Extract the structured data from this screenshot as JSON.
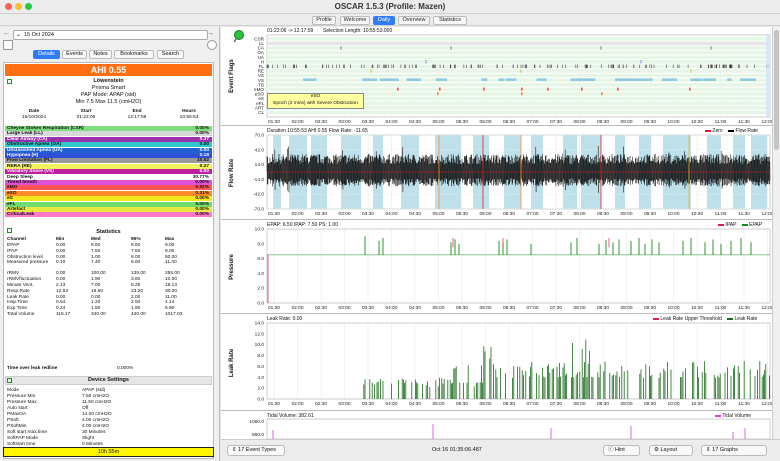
{
  "window": {
    "title": "OSCAR 1.5.3 (Profile: Mazen)"
  },
  "tabs": [
    {
      "label": "Profile"
    },
    {
      "label": "Welcome"
    },
    {
      "label": "Daily"
    },
    {
      "label": "Overview"
    },
    {
      "label": "Statistics"
    }
  ],
  "date": {
    "value": "15 Oct 2024"
  },
  "detail_tabs": [
    {
      "label": "Details"
    },
    {
      "label": "Events"
    },
    {
      "label": "Notes"
    },
    {
      "label": "Bookmarks"
    },
    {
      "label": "Search"
    }
  ],
  "summary": {
    "ahi": "AHI 0.55",
    "machine": "Löwenstein",
    "model": "Prisma Smart",
    "mode": "PAP Mode: APAP (std)",
    "pressure": "Min 7.5 Max 11.5 (cmH2O)"
  },
  "session": {
    "headers": [
      "Date",
      "Start",
      "End",
      "Hours"
    ],
    "values": [
      "16/10/2024",
      "01:22:06",
      "12:17:59",
      "10:55:53"
    ]
  },
  "events": [
    {
      "name": "Cheyne Stokes Respiration (CSR)",
      "value": "0.00%",
      "color": "#7fdc7f"
    },
    {
      "name": "Large Leak (LL)",
      "value": "0.00%",
      "color": "#d8d8d8"
    },
    {
      "name": "Clear Airway (CA)",
      "value": "0.37",
      "color": "#9b2fae",
      "text": "#ffffff"
    },
    {
      "name": "Obstructive Apnea (OA)",
      "value": "0.00",
      "color": "#2ec8c8"
    },
    {
      "name": "Unclassified Apnea (UA)",
      "value": "0.00",
      "color": "#2060d0",
      "text": "#ffffff"
    },
    {
      "name": "Hypopnea (H)",
      "value": "0.18",
      "color": "#2f4fd8",
      "text": "#ffffff"
    },
    {
      "name": "Flow Limitation (FL)",
      "value": "10.52",
      "color": "#9a9a9a"
    },
    {
      "name": "RERA (RE)",
      "value": "0.27",
      "color": "#f2f25a"
    },
    {
      "name": "Vibratory Snore (VS)",
      "value": "0.00",
      "color": "#c020a0",
      "text": "#ffffff"
    },
    {
      "name": "Deep Sleep",
      "value": "30.77%",
      "color": "#ffffff"
    },
    {
      "name": "Timed breath",
      "value": "0.00%",
      "color": "#e050d8"
    },
    {
      "name": "eMO",
      "value": "0.92%",
      "color": "#ff5555"
    },
    {
      "name": "eSO",
      "value": "0.31%",
      "color": "#ff8a2a"
    },
    {
      "name": "eS",
      "value": "0.00%",
      "color": "#f3e61a"
    },
    {
      "name": "eFL",
      "value": "0.00%",
      "color": "#6fdc6f"
    },
    {
      "name": "Artefact",
      "value": "0.00%",
      "color": "#e8e840"
    },
    {
      "name": "CriticalLeak",
      "value": "0.00%",
      "color": "#ff77c8"
    }
  ],
  "statistics": {
    "title": "Statistics",
    "headers": [
      "Channel",
      "Min",
      "Med",
      "95%",
      "Max"
    ],
    "rows": [
      [
        "EPAP",
        "0.00",
        "6.50",
        "6.50",
        "9.00"
      ],
      [
        "IPAP",
        "0.00",
        "7.50",
        "7.50",
        "9.00"
      ],
      [
        "Obstruction level",
        "0.00",
        "1.00",
        "8.00",
        "50.00"
      ],
      [
        "Measured pressure",
        "0.10",
        "7.40",
        "8.60",
        "11.40"
      ],
      [
        "rRMV",
        "0.00",
        "100.00",
        "135.00",
        "255.00"
      ],
      [
        "rRMVfluctuation",
        "0.00",
        "1.90",
        "3.60",
        "10.00"
      ],
      [
        "Minute Vent.",
        "2.13",
        "7.00",
        "9.25",
        "18.13"
      ],
      [
        "Resp.Rate",
        "12.93",
        "19.60",
        "23.20",
        "30.00"
      ],
      [
        "Leak Rate",
        "0.00",
        "0.00",
        "2.00",
        "11.00"
      ],
      [
        "Insp.Time",
        "0.54",
        "1.20",
        "2.50",
        "4.14"
      ],
      [
        "Exp.Time",
        "0.24",
        "1.50",
        "1.90",
        "5.90"
      ],
      [
        "Total Volume",
        "115.17",
        "340.00",
        "440.00",
        "1017.03"
      ]
    ],
    "leak_label": "Time over leak redline",
    "leak_value": "0.000%"
  },
  "device_settings": {
    "title": "Device Settings",
    "rows": [
      [
        "Mode",
        "APAP (std)"
      ],
      [
        "Pressure Min",
        "7.50 cmH2O"
      ],
      [
        "Pressure Max",
        "11.50 cmH2O"
      ],
      [
        "Auto start",
        "Off"
      ],
      [
        "PMaxOA",
        "14.00 cmH2O"
      ],
      [
        "PSoft",
        "4.00 cmH2O"
      ],
      [
        "PSoftMin",
        "4.00 cmH2O"
      ],
      [
        "Soft start max.time",
        "30 Minutes"
      ],
      [
        "SoftPAP Mode",
        "Slight"
      ],
      [
        "Softstart time",
        "0 Minutes"
      ],
      [
        "Tube type",
        "1.50 cm"
      ]
    ]
  },
  "total_time": "10h 55m",
  "graphs": {
    "x_ticks": [
      "01:30",
      "02:00",
      "02:30",
      "03:00",
      "03:30",
      "04:00",
      "04:30",
      "05:00",
      "05:30",
      "06:00",
      "06:30",
      "07:00",
      "07:30",
      "08:00",
      "08:30",
      "09:00",
      "09:30",
      "10:00",
      "10:30",
      "11:00",
      "11:30",
      "12:00"
    ],
    "event_flags": {
      "label": "Event Flags",
      "range": "01:22:06 -> 12:17:59",
      "selection": "Selection Length: 10:55:53.000",
      "rows": [
        "CSR",
        "LL",
        "CA",
        "OA",
        "UA",
        "H",
        "FL",
        "RE",
        "VS",
        "VS2",
        "TB",
        "eMO",
        "eSO",
        "eS",
        "eFL",
        "ART",
        "CL"
      ],
      "tooltip_title": "eSO",
      "tooltip_text": "Epoch (2 mins) with Severe Obstruction"
    },
    "flow_rate": {
      "label": "Flow Rate",
      "header": "Duration 10:55:53 AHI 0.55 Flow Rate: -11.65",
      "y_ticks": [
        "70.0",
        "42.0",
        "14.0",
        "-14.0",
        "-42.0",
        "-70.0"
      ],
      "legend": [
        "Zero",
        "Flow Rate"
      ]
    },
    "pressure": {
      "label": "Pressure",
      "header": "EPAP: 6.50 IPAP: 7.50 PS: 1.00",
      "y_ticks": [
        "10.0",
        "8.0",
        "6.0",
        "4.0",
        "2.0",
        "0.0"
      ],
      "legend": [
        "IPAP",
        "EPAP"
      ]
    },
    "leak_rate": {
      "label": "Leak Rate",
      "header": "Leak Rate: 0.00",
      "y_ticks": [
        "14.0",
        "12.0",
        "10.0",
        "8.0",
        "6.0",
        "4.0",
        "2.0",
        "0.0"
      ],
      "legend": [
        "Leak Rate Upper Threshold",
        "Leak Rate"
      ]
    },
    "tidal_volume": {
      "label": "Tidal Volume",
      "header": "Tidal Volume: 382.61",
      "y_ticks": [
        "1060.0",
        "860.0"
      ],
      "legend": [
        "Tidal Volume"
      ]
    }
  },
  "bottom": {
    "event_types": "17 Event Types",
    "datetime": "Oct 16 01:35:06.487",
    "hint": "Hint",
    "layout": "Layout",
    "graphs": "17 Graphs"
  }
}
